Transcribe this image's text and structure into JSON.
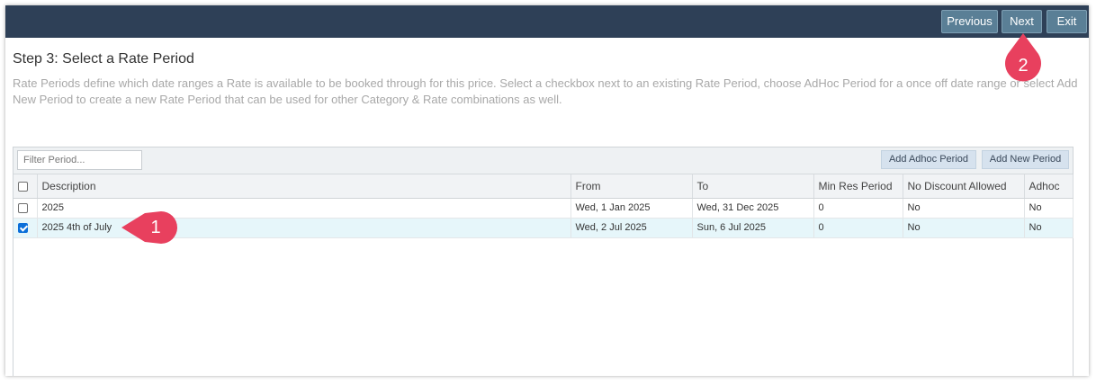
{
  "toolbar": {
    "previous_label": "Previous",
    "next_label": "Next",
    "exit_label": "Exit"
  },
  "step": {
    "title": "Step 3: Select a Rate Period",
    "description": "Rate Periods define which date ranges a Rate is available to be booked through for this price. Select a checkbox next to an existing Rate Period, choose AdHoc Period for a once off date range or select Add New Period to create a new Rate Period that can be used for other Category & Rate combinations as well."
  },
  "filter": {
    "placeholder": "Filter Period..."
  },
  "actions": {
    "add_adhoc_label": "Add Adhoc Period",
    "add_new_label": "Add New Period"
  },
  "table": {
    "headers": [
      "Description",
      "From",
      "To",
      "Min Res Period",
      "No Discount Allowed",
      "Adhoc"
    ],
    "rows": [
      {
        "checked": false,
        "cells": [
          "2025",
          "Wed, 1 Jan 2025",
          "Wed, 31 Dec 2025",
          "0",
          "No",
          "No"
        ]
      },
      {
        "checked": true,
        "cells": [
          "2025 4th of July",
          "Wed, 2 Jul 2025",
          "Sun, 6 Jul 2025",
          "0",
          "No",
          "No"
        ]
      }
    ]
  },
  "annotations": {
    "marker_1": "1",
    "marker_2": "2",
    "color": "#e8405e"
  },
  "colors": {
    "topbar": "#2e4057",
    "button": "#5a7f96",
    "selected_row": "#e6f6fa",
    "checkbox_checked": "#0b6fd9"
  }
}
